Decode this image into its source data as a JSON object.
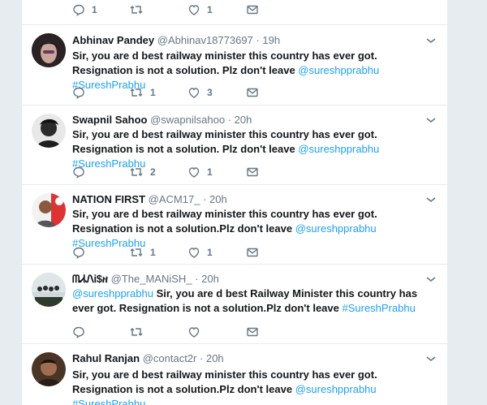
{
  "top_tweet": {
    "reply_count": "1",
    "retweet_count": "",
    "like_count": "1"
  },
  "tweets": [
    {
      "name": "Abhinav Pandey",
      "handle": "@Abhinav18773697",
      "time": "19h",
      "text": "Sir, you are d best railway minister this country has ever got. Resignation is not a solution. Plz don't leave ",
      "mention": "@sureshpprabhu",
      "hashtag": "#SureshPrabhu",
      "reply_count": "",
      "retweet_count": "1",
      "like_count": "3"
    },
    {
      "name": "Swapnil Sahoo",
      "handle": "@swapnilsahoo",
      "time": "20h",
      "text": "Sir, you are d best railway minister this country has ever got. Resignation is not a solution. Plz don't leave",
      "mention": "@sureshpprabhu",
      "hashtag": "#SureshPrabhu",
      "reply_count": "",
      "retweet_count": "2",
      "like_count": "1"
    },
    {
      "name": "NATION FIRST",
      "handle": "@ACM17_",
      "time": "20h",
      "text": "Sir, you are d best railway minister this country has ever got. Resignation is not a solution.Plz don't leave",
      "mention": "@sureshpprabhu",
      "hashtag": "#SureshPrabhu",
      "reply_count": "",
      "retweet_count": "1",
      "like_count": "1"
    },
    {
      "name": "ᗰᏗᏁᎥ$ዘ",
      "handle": "@The_MANiSH_",
      "time": "20h",
      "mention": "@sureshpprabhu",
      "text": "Sir, you are d best Railway Minister this country has ever got. Resignation is not a solution.Plz don't leave",
      "hashtag": "#SureshPrabhu",
      "reply_count": "",
      "retweet_count": "",
      "like_count": ""
    },
    {
      "name": "Rahul Ranjan",
      "handle": "@contact2r",
      "time": "20h",
      "text": "Sir, you are d best railway minister this country has ever got. Resignation is not a solution.Plz don't leave",
      "mention": "@sureshpprabhu",
      "hashtag": "#SureshPrabhu"
    }
  ],
  "separator": "·",
  "colors": {
    "link": "#1da1f2",
    "text": "#14171a",
    "muted": "#657786",
    "border": "#e6ecf0"
  },
  "icons": {
    "reply": "reply-icon",
    "retweet": "retweet-icon",
    "like": "heart-icon",
    "dm": "envelope-icon",
    "caret": "chevron-down-icon"
  }
}
